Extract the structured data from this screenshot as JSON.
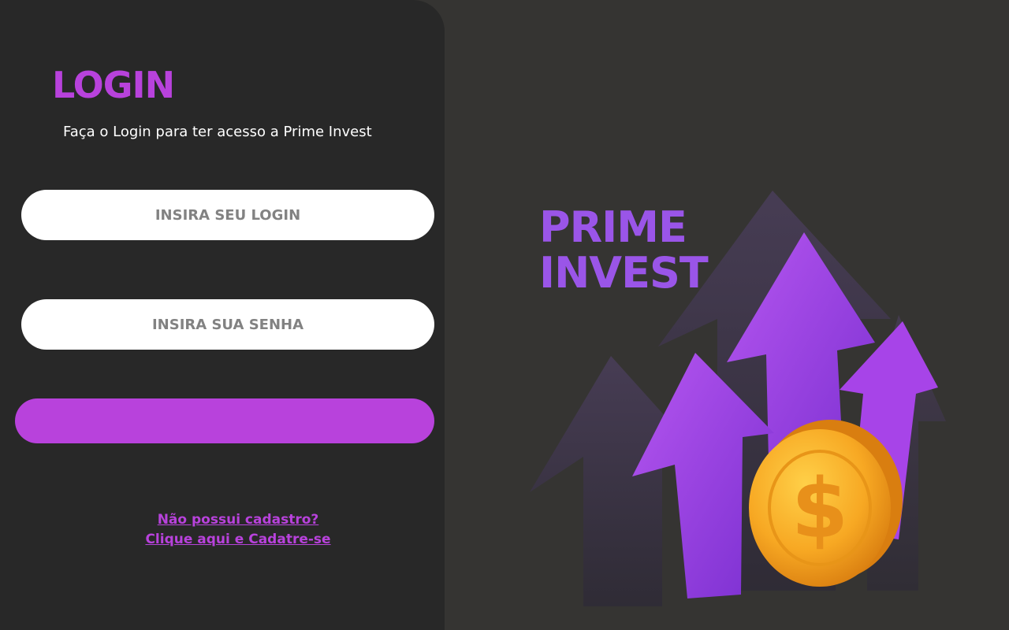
{
  "login": {
    "title": "LOGIN",
    "subtitle": "Faça o Login para ter acesso a Prime Invest",
    "username_placeholder": "INSIRA SEU LOGIN",
    "password_placeholder": "INSIRA SUA SENHA",
    "no_account_text": "Não possui cadastro?",
    "signup_link_text": "Clique aqui e Cadatre-se"
  },
  "brand": {
    "line1": "PRIME",
    "line2": "INVEST"
  },
  "illustration": {
    "arrow_icon": "arrow-up-icon",
    "coin_icon": "dollar-coin-icon",
    "symbol": "$"
  },
  "colors": {
    "accent": "#b842dc",
    "brand_text": "#9a55e8",
    "panel": "#282828",
    "background": "#353432",
    "coin": "#f7a823"
  }
}
